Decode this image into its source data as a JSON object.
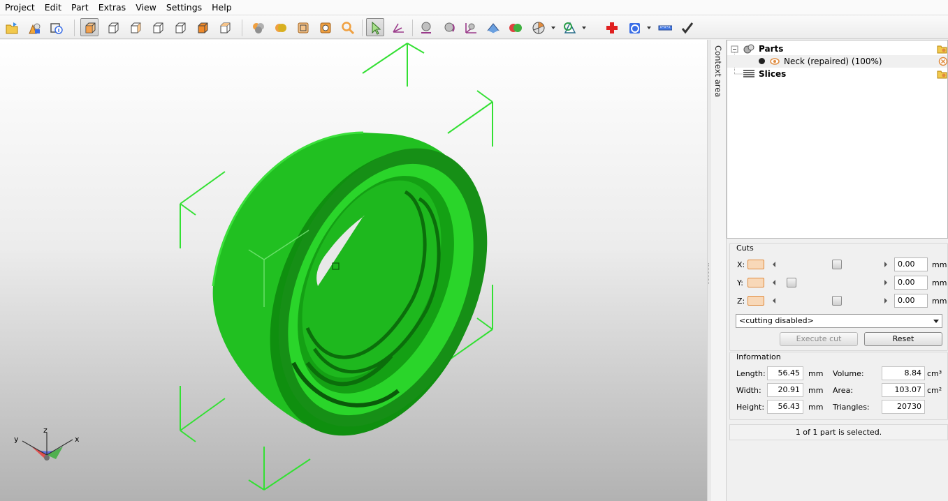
{
  "menu": {
    "items": [
      "Project",
      "Edit",
      "Part",
      "Extras",
      "View",
      "Settings",
      "Help"
    ]
  },
  "toolbar": {
    "icons": [
      "open-project-icon",
      "add-part-icon",
      "part-info-icon",
      "view-default-icon",
      "view-front-icon",
      "view-back-icon",
      "view-left-icon",
      "view-right-icon",
      "view-top-icon",
      "view-bottom-icon",
      "render-points-icon",
      "render-shaded-icon",
      "render-wireframe-icon",
      "render-shaded-wire-icon",
      "zoom-icon",
      "select-icon",
      "move-axis-icon",
      "sphere-icon",
      "rotate-icon",
      "move-icon",
      "scale-icon",
      "boolean-icon",
      "section-icon",
      "measure-cone-icon",
      "add-red-cross-icon",
      "repair-icon",
      "ruler-icon",
      "checkmark-icon"
    ]
  },
  "colors": {
    "model": "#1fc81f",
    "model_dark": "#0b6e0b",
    "bbox": "#33e033",
    "accent_orange": "#e08b3e",
    "axis_x": "#e05050",
    "axis_y": "#50b050",
    "axis_z": "#5060e0"
  },
  "viewport": {
    "axes": {
      "x": "x",
      "y": "y",
      "z": "z"
    }
  },
  "context_tab": {
    "label": "Context area"
  },
  "tree": {
    "parts_label": "Parts",
    "part_name": "Neck (repaired) (100%)",
    "slices_label": "Slices"
  },
  "cuts": {
    "title": "Cuts",
    "rows": [
      {
        "axis": "X:",
        "value": "0.00",
        "unit": "mm",
        "position": 0.55
      },
      {
        "axis": "Y:",
        "value": "0.00",
        "unit": "mm",
        "position": 0.1
      },
      {
        "axis": "Z:",
        "value": "0.00",
        "unit": "mm",
        "position": 0.55
      }
    ],
    "mode": "<cutting disabled>",
    "execute_label": "Execute cut",
    "reset_label": "Reset"
  },
  "info": {
    "title": "Information",
    "length_label": "Length:",
    "length_value": "56.45",
    "length_unit": "mm",
    "width_label": "Width:",
    "width_value": "20.91",
    "width_unit": "mm",
    "height_label": "Height:",
    "height_value": "56.43",
    "height_unit": "mm",
    "volume_label": "Volume:",
    "volume_value": "8.84",
    "volume_unit": "cm³",
    "area_label": "Area:",
    "area_value": "103.07",
    "area_unit": "cm²",
    "triangles_label": "Triangles:",
    "triangles_value": "20730"
  },
  "status": {
    "text": "1 of 1 part is selected."
  }
}
